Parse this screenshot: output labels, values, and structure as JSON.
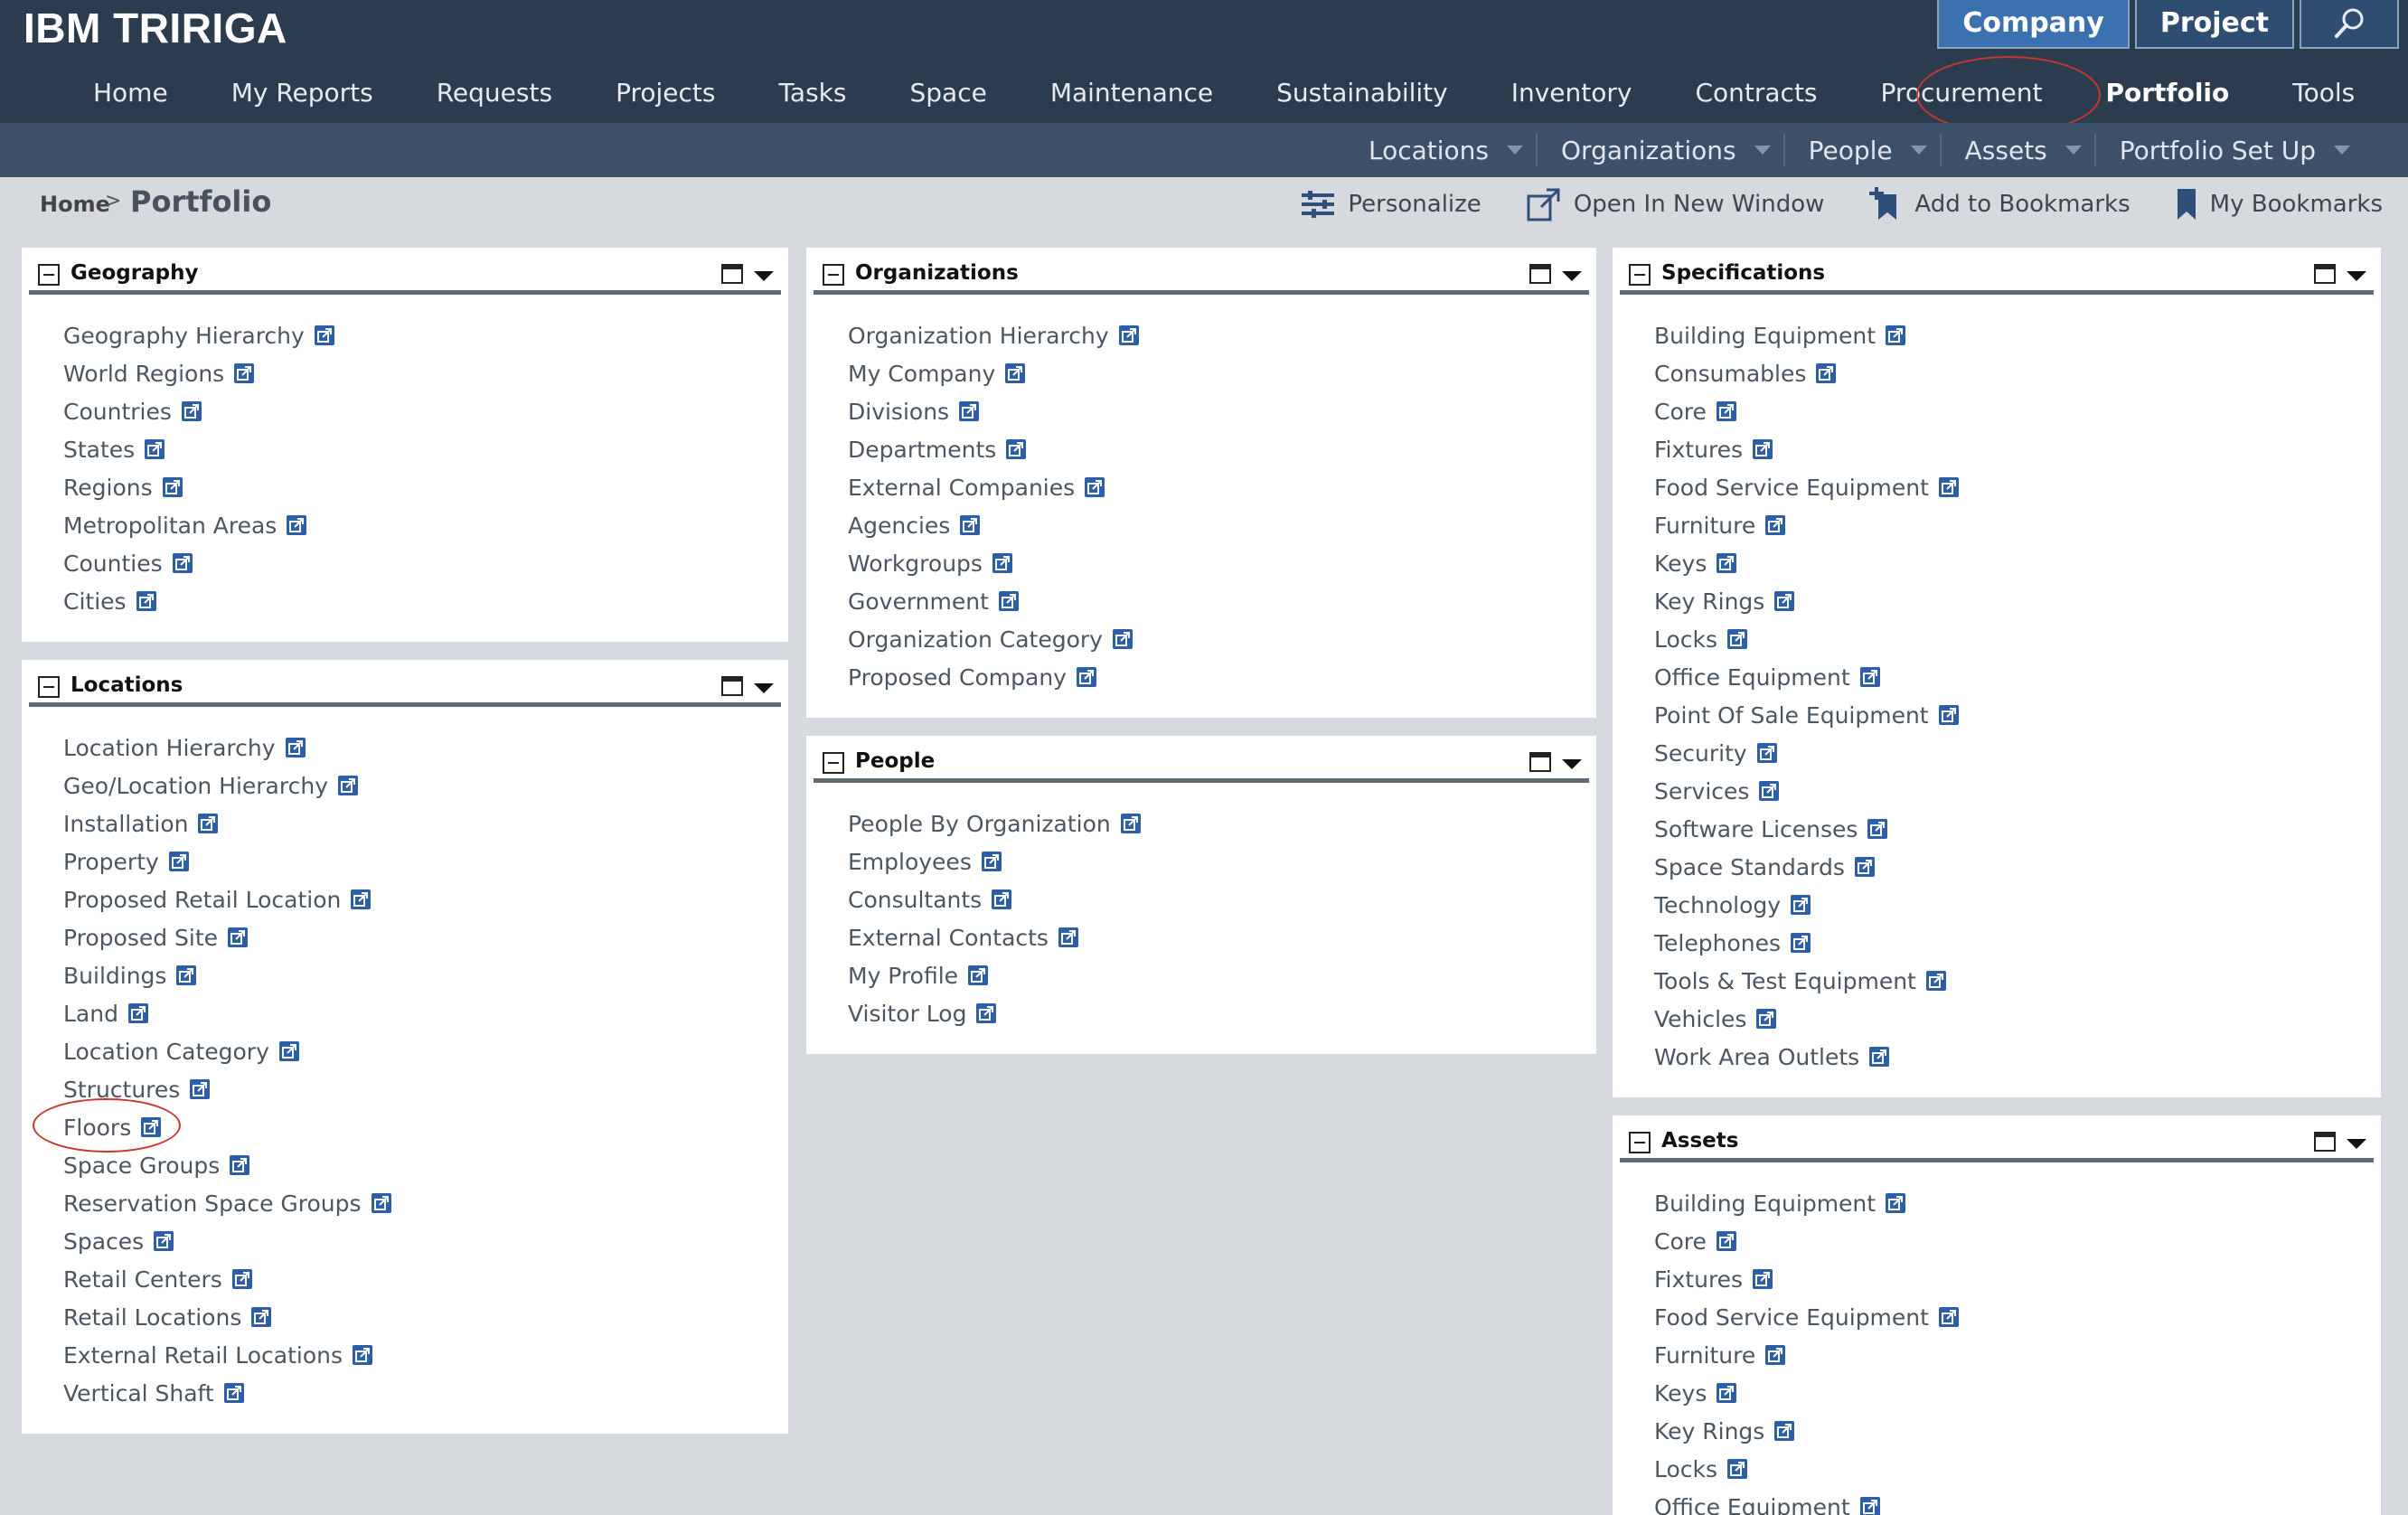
{
  "app": {
    "brand": "IBM TRIRIGA",
    "switcher": [
      "Company",
      "Project"
    ],
    "search_icon": "magnifier-icon"
  },
  "main_nav": [
    "Home",
    "My Reports",
    "Requests",
    "Projects",
    "Tasks",
    "Space",
    "Maintenance",
    "Sustainability",
    "Inventory",
    "Contracts",
    "Procurement",
    "Portfolio",
    "Tools"
  ],
  "active_tab": "Portfolio",
  "sub_nav": [
    "Locations",
    "Organizations",
    "People",
    "Assets",
    "Portfolio Set Up"
  ],
  "breadcrumb": {
    "home": "Home",
    "separator": ">",
    "current": "Portfolio"
  },
  "toolbar": {
    "personalize": "Personalize",
    "open_new_window": "Open In New Window",
    "add_bookmarks": "Add to Bookmarks",
    "my_bookmarks": "My Bookmarks"
  },
  "panels": {
    "geography": {
      "title": "Geography",
      "items": [
        "Geography Hierarchy",
        "World Regions",
        "Countries",
        "States",
        "Regions",
        "Metropolitan Areas",
        "Counties",
        "Cities"
      ]
    },
    "locations": {
      "title": "Locations",
      "items": [
        "Location Hierarchy",
        "Geo/Location Hierarchy",
        "Installation",
        "Property",
        "Proposed Retail Location",
        "Proposed Site",
        "Buildings",
        "Land",
        "Location Category",
        "Structures",
        "Floors",
        "Space Groups",
        "Reservation Space Groups",
        "Spaces",
        "Retail Centers",
        "Retail Locations",
        "External Retail Locations",
        "Vertical Shaft"
      ]
    },
    "organizations": {
      "title": "Organizations",
      "items": [
        "Organization Hierarchy",
        "My Company",
        "Divisions",
        "Departments",
        "External Companies",
        "Agencies",
        "Workgroups",
        "Government",
        "Organization Category",
        "Proposed Company"
      ]
    },
    "people": {
      "title": "People",
      "items": [
        "People By Organization",
        "Employees",
        "Consultants",
        "External Contacts",
        "My Profile",
        "Visitor Log"
      ]
    },
    "specifications": {
      "title": "Specifications",
      "items": [
        "Building Equipment",
        "Consumables",
        "Core",
        "Fixtures",
        "Food Service Equipment",
        "Furniture",
        "Keys",
        "Key Rings",
        "Locks",
        "Office Equipment",
        "Point Of Sale Equipment",
        "Security",
        "Services",
        "Software Licenses",
        "Space Standards",
        "Technology",
        "Telephones",
        "Tools & Test Equipment",
        "Vehicles",
        "Work Area Outlets"
      ]
    },
    "assets": {
      "title": "Assets",
      "items": [
        "Building Equipment",
        "Core",
        "Fixtures",
        "Food Service Equipment",
        "Furniture",
        "Keys",
        "Key Rings",
        "Locks",
        "Office Equipment"
      ]
    }
  },
  "colors": {
    "header_bg": "#2b3c4f",
    "subnav_bg": "#3c5068",
    "active_switch": "#3c71b0",
    "annotation_red": "#c9372c",
    "link_icon_blue": "#2d5ea8"
  }
}
